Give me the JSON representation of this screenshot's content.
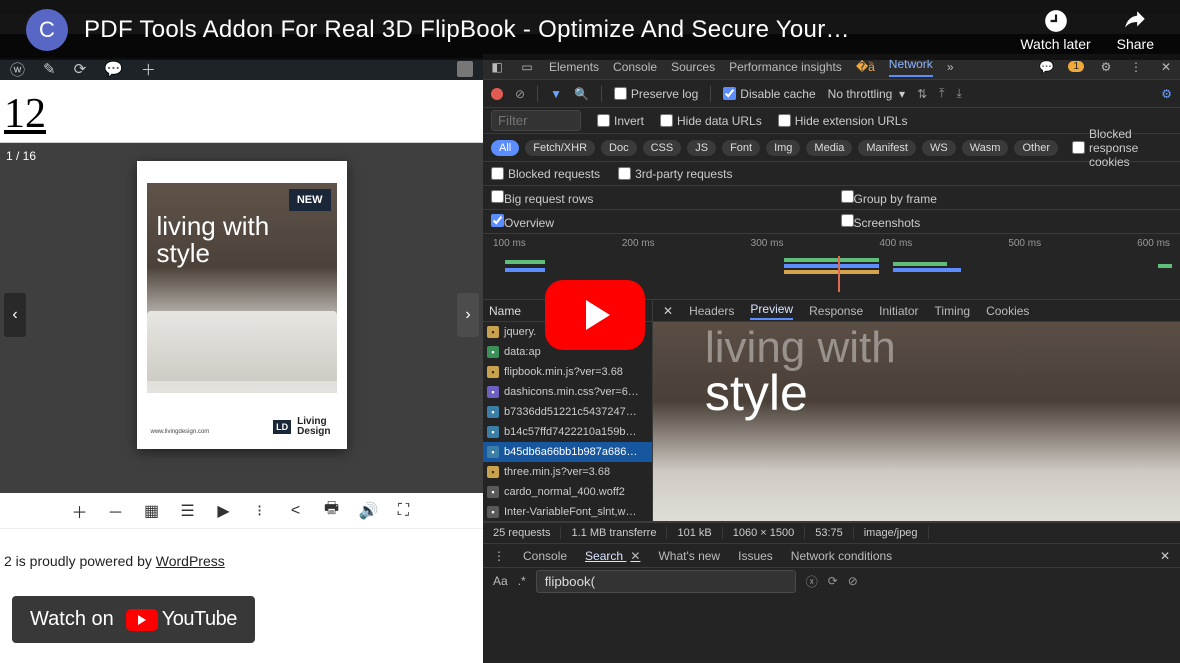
{
  "youtube": {
    "avatar_letter": "C",
    "title": "PDF Tools Addon For Real 3D FlipBook - Optimize And Secure Your…",
    "watch_later": "Watch later",
    "share": "Share",
    "watch_on": "Watch on",
    "youtube_word": "YouTube"
  },
  "wp_page": {
    "title": "12",
    "page_counter": "1 / 16",
    "new_badge": "NEW",
    "headline_1": "living with",
    "headline_2": "style",
    "brand_code": "LD",
    "brand_name": "Living\nDesign",
    "brand_url": "www.livingdesign.com",
    "footer_prefix": "2 is proudly powered by ",
    "footer_link": "WordPress"
  },
  "devtools": {
    "main_tabs": [
      "Elements",
      "Console",
      "Sources",
      "Performance insights"
    ],
    "network_tab": "Network",
    "warn_count": "1",
    "preserve_log": "Preserve log",
    "disable_cache": "Disable cache",
    "throttling": "No throttling",
    "filter_placeholder": "Filter",
    "invert": "Invert",
    "hide_data": "Hide data URLs",
    "hide_ext": "Hide extension URLs",
    "types": [
      "All",
      "Fetch/XHR",
      "Doc",
      "CSS",
      "JS",
      "Font",
      "Img",
      "Media",
      "Manifest",
      "WS",
      "Wasm",
      "Other"
    ],
    "blocked_cookies": "Blocked response cookies",
    "blocked_requests": "Blocked requests",
    "third_party": "3rd-party requests",
    "big_rows": "Big request rows",
    "group_frame": "Group by frame",
    "overview": "Overview",
    "screenshots": "Screenshots",
    "ticks": [
      "100 ms",
      "200 ms",
      "300 ms",
      "400 ms",
      "500 ms",
      "600 ms"
    ],
    "name_hdr": "Name",
    "requests": [
      {
        "ic": "js",
        "name": "jquery."
      },
      {
        "ic": "txt",
        "name": "data:ap"
      },
      {
        "ic": "js",
        "name": "flipbook.min.js?ver=3.68"
      },
      {
        "ic": "css",
        "name": "dashicons.min.css?ver=6…"
      },
      {
        "ic": "img",
        "name": "b7336dd51221c5437247…"
      },
      {
        "ic": "img",
        "name": "b14c57ffd7422210a159b…"
      },
      {
        "ic": "img",
        "name": "b45db6a66bb1b987a686…"
      },
      {
        "ic": "js",
        "name": "three.min.js?ver=3.68"
      },
      {
        "ic": "font",
        "name": "cardo_normal_400.woff2"
      },
      {
        "ic": "font",
        "name": "Inter-VariableFont_slnt,w…"
      }
    ],
    "selected_index": 6,
    "detail_tabs": [
      "Headers",
      "Preview",
      "Response",
      "Initiator",
      "Timing",
      "Cookies"
    ],
    "detail_active": "Preview",
    "status_cells": [
      "25 requests",
      "1.1 MB transferre",
      "101 kB",
      "1060 × 1500",
      "53:75",
      "image/jpeg"
    ],
    "drawer_tabs": [
      "Console",
      "Search",
      "What's new",
      "Issues",
      "Network conditions"
    ],
    "drawer_active": "Search",
    "search_value": "flipbook(",
    "preview_headline_2": "style"
  }
}
